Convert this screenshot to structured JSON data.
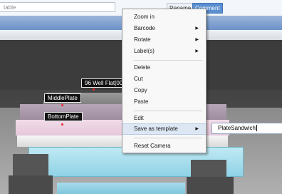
{
  "toolbar": {
    "name_value": "table",
    "rename_label": "Rename",
    "comment_label": "Comment"
  },
  "viewport": {
    "labels": {
      "plate96": "96 Well Flat[001",
      "middle": "MiddlePlate",
      "bottom": "BottomPlate"
    }
  },
  "menu": {
    "items": [
      {
        "label": "Zoom in",
        "has_submenu": false
      },
      {
        "label": "Barcode",
        "has_submenu": true
      },
      {
        "label": "Rotate",
        "has_submenu": true
      },
      {
        "label": "Label(s)",
        "has_submenu": true
      },
      {
        "label": "Delete",
        "has_submenu": false
      },
      {
        "label": "Cut",
        "has_submenu": false
      },
      {
        "label": "Copy",
        "has_submenu": false
      },
      {
        "label": "Paste",
        "has_submenu": false
      },
      {
        "label": "Edit",
        "has_submenu": false
      },
      {
        "label": "Save as template",
        "has_submenu": true,
        "highlighted": true
      },
      {
        "label": "Reset Camera",
        "has_submenu": false
      }
    ],
    "arrow_glyph": "▶"
  },
  "template_name_input": {
    "value": "PlateSandwich"
  },
  "colors": {
    "menu_highlight": "#dde7f4",
    "label_bg": "#111111",
    "marker": "#e8262a"
  }
}
